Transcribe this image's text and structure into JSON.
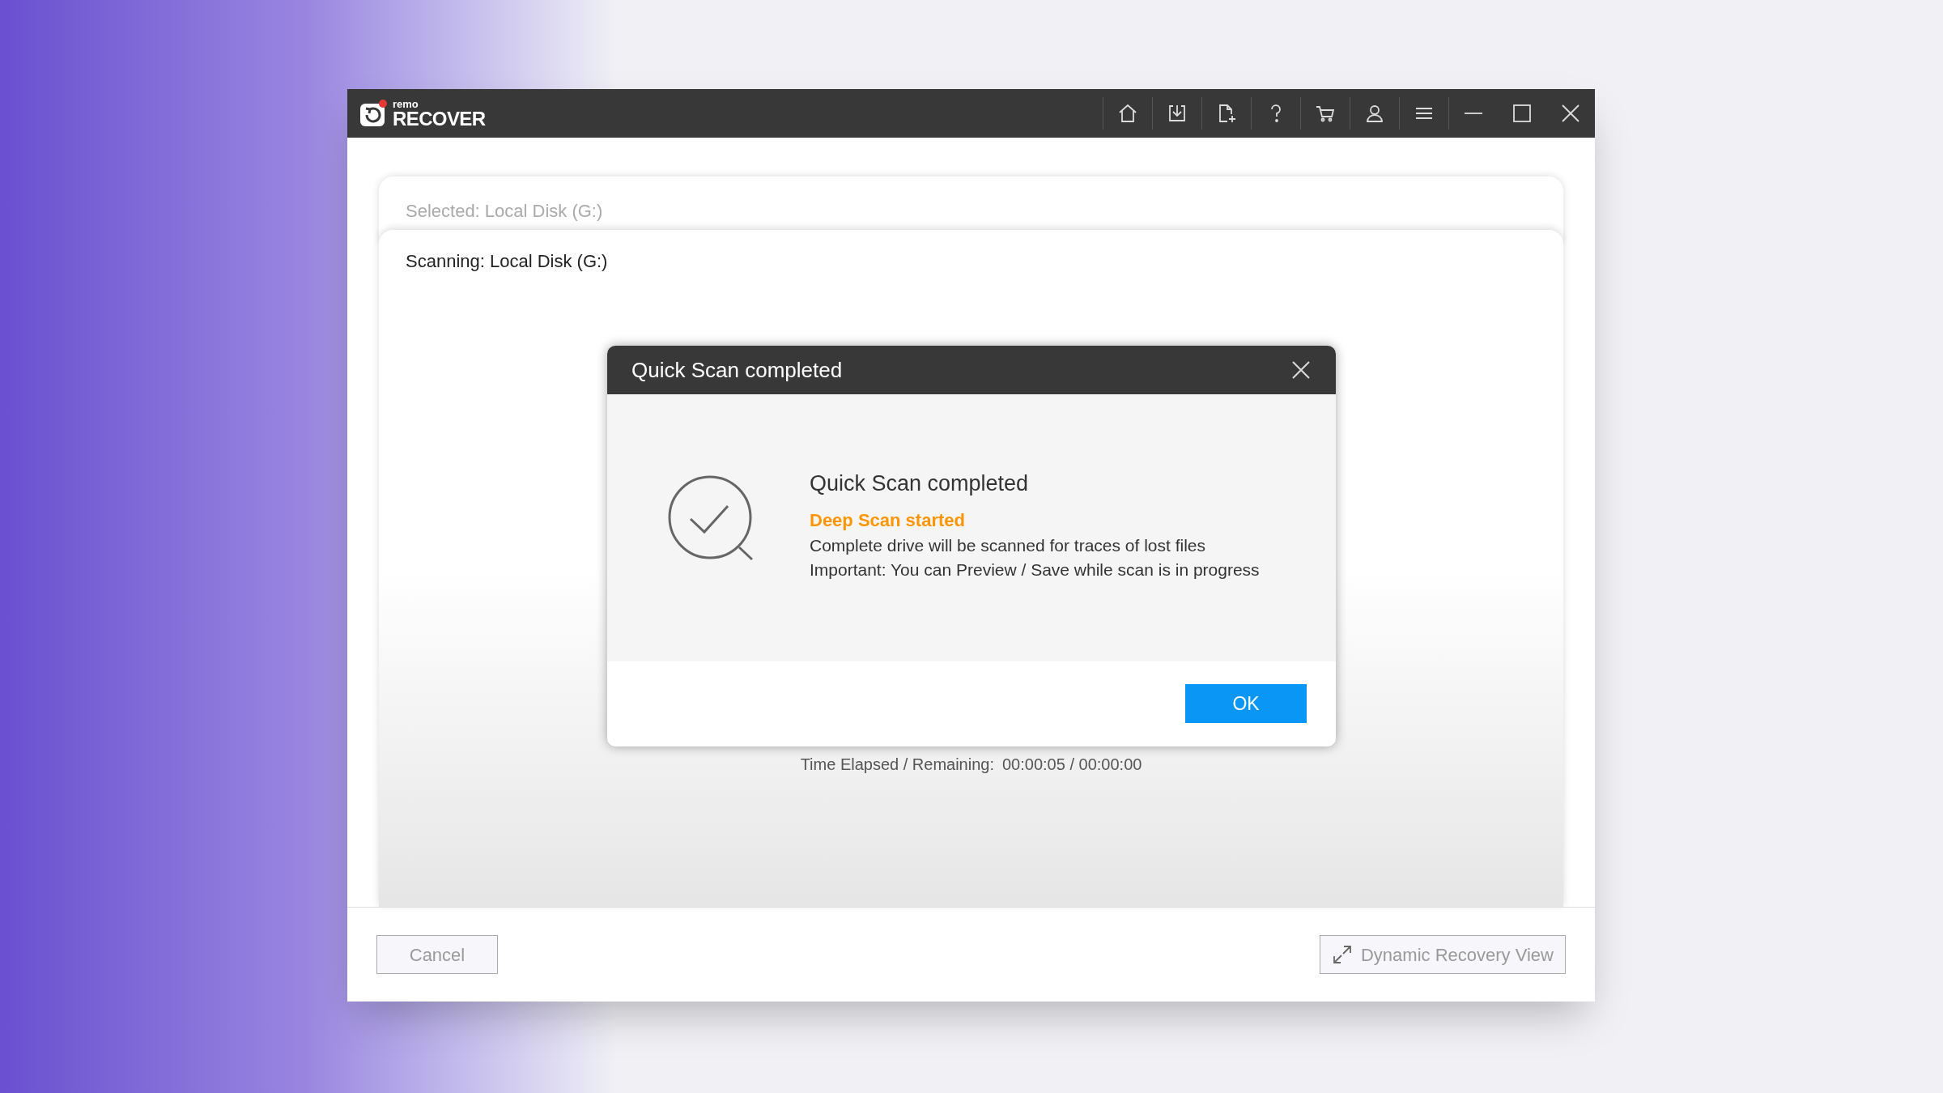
{
  "logo": {
    "small": "remo",
    "big": "RECOVER"
  },
  "panel": {
    "selected_label": "Selected: Local Disk (G:)",
    "scanning_label": "Scanning: Local Disk (G:)",
    "time_label": "Time Elapsed / Remaining:",
    "time_value": "00:00:05 / 00:00:00"
  },
  "dialog": {
    "title": "Quick Scan completed",
    "heading": "Quick Scan completed",
    "status": "Deep Scan started",
    "lines": [
      "Complete drive will be scanned for traces of lost files",
      "Important: You can Preview / Save while scan is in progress"
    ],
    "ok": "OK"
  },
  "footer": {
    "cancel": "Cancel",
    "dynamic": "Dynamic Recovery View"
  }
}
